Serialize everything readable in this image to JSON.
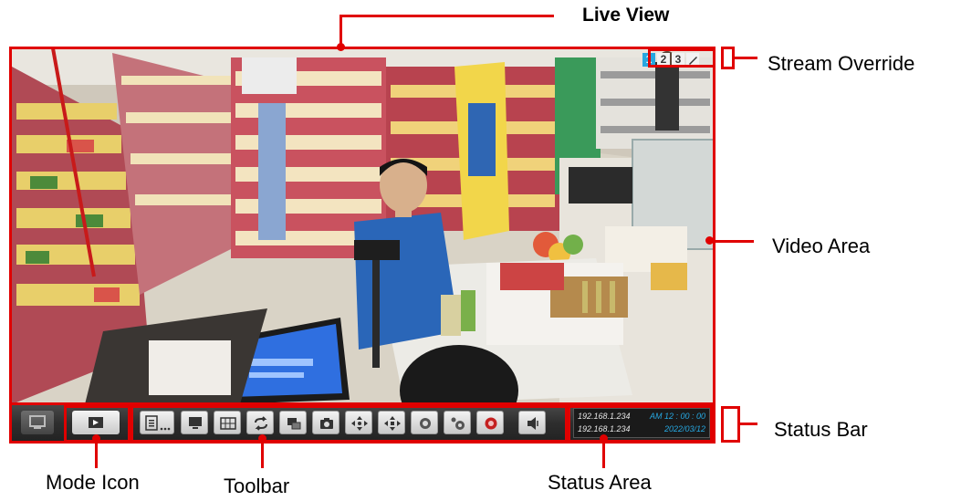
{
  "callouts": {
    "live_view": "Live View",
    "stream_override": "Stream Override",
    "video_area": "Video Area",
    "status_bar": "Status Bar",
    "mode_icon": "Mode Icon",
    "toolbar": "Toolbar",
    "status_area": "Status Area"
  },
  "stream_override": {
    "buttons": [
      "1",
      "2",
      "3"
    ]
  },
  "status_area": {
    "ip_1": "192.168.1.234",
    "ip_2": "192.168.1.234",
    "time": "AM 12 : 00 : 00",
    "date": "2022/03/12"
  },
  "toolbar_icons": [
    "menu-icon",
    "monitor-icon",
    "grid-layout-icon",
    "cycle-icon",
    "pip-icon",
    "snapshot-icon",
    "ptz-icon",
    "ptz-move-icon",
    "record-icon",
    "zoom-record-icon",
    "event-record-icon",
    "speaker-icon"
  ],
  "colors": {
    "annotation": "#e00000",
    "accent_cyan": "#27a7e0",
    "toolbar_bg": "#2e2e2e"
  }
}
